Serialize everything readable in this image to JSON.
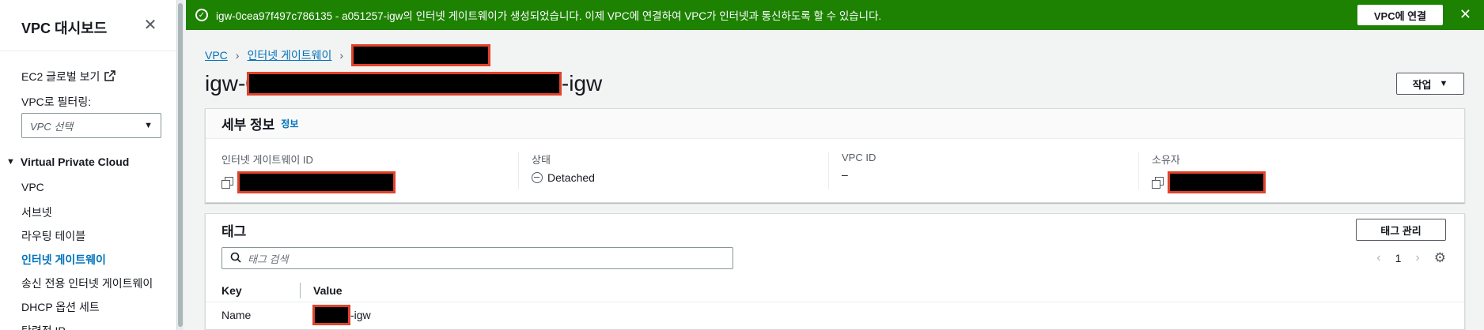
{
  "sidebar": {
    "title": "VPC 대시보드",
    "ec2_link": "EC2 글로벌 보기",
    "filter_label": "VPC로 필터링:",
    "filter_placeholder": "VPC 선택",
    "section": "Virtual Private Cloud",
    "items": [
      {
        "label": "VPC"
      },
      {
        "label": "서브넷"
      },
      {
        "label": "라우팅 테이블"
      },
      {
        "label": "인터넷 게이트웨이",
        "active": true
      },
      {
        "label": "송신 전용 인터넷 게이트웨이"
      },
      {
        "label": "DHCP 옵션 세트"
      },
      {
        "label": "탄력적 IP"
      }
    ]
  },
  "flash": {
    "message": "igw-0cea97f497c786135 - a051257-igw의 인터넷 게이트웨이가 생성되었습니다. 이제 VPC에 연결하여 VPC가 인터넷과 통신하도록 할 수 있습니다.",
    "button": "VPC에 연결",
    "color": "#1d8102"
  },
  "breadcrumb": {
    "vpc": "VPC",
    "igw": "인터넷 게이트웨이"
  },
  "title": {
    "prefix": "igw-0",
    "suffix": "-igw"
  },
  "actions_button": "작업",
  "details": {
    "heading": "세부 정보",
    "info": "정보",
    "igw_id_label": "인터넷 게이트웨이 ID",
    "state_label": "상태",
    "state_value": "Detached",
    "vpc_id_label": "VPC ID",
    "vpc_id_value": "–",
    "owner_label": "소유자"
  },
  "tags": {
    "heading": "태그",
    "manage_button": "태그 관리",
    "search_placeholder": "태그 검색",
    "page": "1",
    "columns": [
      "Key",
      "Value"
    ],
    "rows": [
      {
        "key": "Name",
        "value_suffix": "-igw"
      }
    ]
  }
}
